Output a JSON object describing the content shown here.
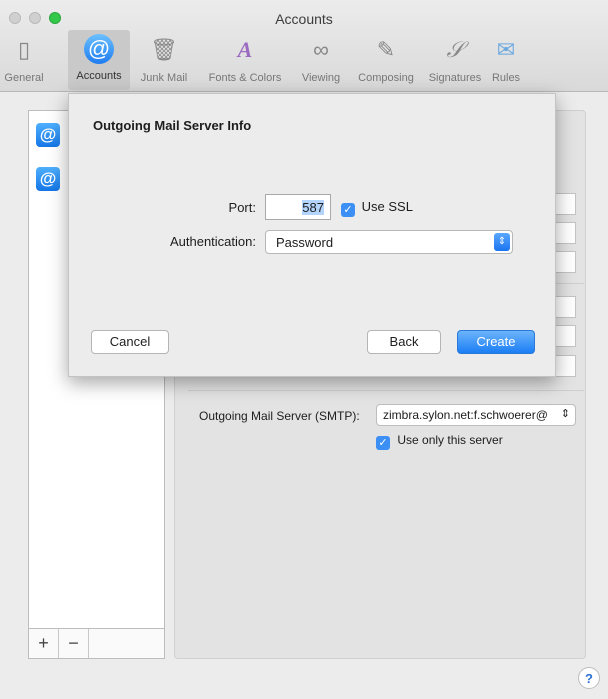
{
  "window": {
    "title": "Accounts"
  },
  "toolbar": {
    "items": [
      {
        "label": "General",
        "icon": "general-icon"
      },
      {
        "label": "Accounts",
        "icon": "at-icon"
      },
      {
        "label": "Junk Mail",
        "icon": "junk-mail-icon"
      },
      {
        "label": "Fonts & Colors",
        "icon": "fonts-colors-icon"
      },
      {
        "label": "Viewing",
        "icon": "viewing-glasses-icon"
      },
      {
        "label": "Composing",
        "icon": "pencil-icon"
      },
      {
        "label": "Signatures",
        "icon": "signature-icon"
      },
      {
        "label": "Rules",
        "icon": "rules-icon"
      }
    ]
  },
  "sheet": {
    "title": "Outgoing Mail Server Info",
    "port_label": "Port:",
    "port_value": "587",
    "use_ssl_label": "Use SSL",
    "use_ssl_checked": true,
    "auth_label": "Authentication:",
    "auth_value": "Password",
    "cancel_label": "Cancel",
    "back_label": "Back",
    "create_label": "Create"
  },
  "panel": {
    "smtp_label": "Outgoing Mail Server (SMTP):",
    "smtp_value": "zimbra.sylon.net:f.schwoerer@",
    "use_only_label": "Use only this server",
    "use_only_checked": true
  },
  "sidebar": {
    "add_label": "+",
    "remove_label": "−"
  },
  "help_label": "?",
  "colors": {
    "accent": "#1b7ef5",
    "selection": "#b3d4fd"
  }
}
